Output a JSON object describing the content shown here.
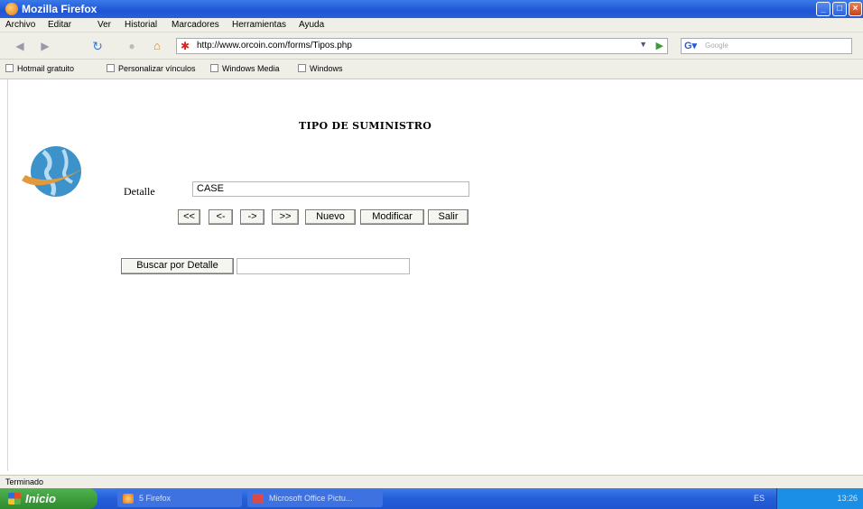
{
  "window": {
    "title": "Mozilla Firefox"
  },
  "menu": [
    "Archivo",
    "Editar",
    "Ver",
    "Historial",
    "Marcadores",
    "Herramientas",
    "Ayuda"
  ],
  "address": {
    "url": "http://www.orcoin.com/forms/Tipos.php"
  },
  "search": {
    "placeholder": "Google"
  },
  "bookmarks": [
    "Hotmail gratuito",
    "Personalizar vínculos",
    "Windows Media",
    "Windows"
  ],
  "page": {
    "title": "TIPO DE SUMINISTRO",
    "detail_label": "Detalle",
    "detail_value": "CASE",
    "nav_buttons": {
      "first": "<<",
      "prev": "<-",
      "next": "->",
      "last": ">>",
      "new": "Nuevo",
      "modify": "Modificar",
      "exit": "Salir"
    },
    "search_button": "Buscar por Detalle",
    "search_value": ""
  },
  "status": "Terminado",
  "taskbar": {
    "start": "Inicio",
    "tasks": [
      "5 Firefox",
      "Microsoft Office Pictu..."
    ],
    "language": "ES",
    "time": "13:26"
  }
}
